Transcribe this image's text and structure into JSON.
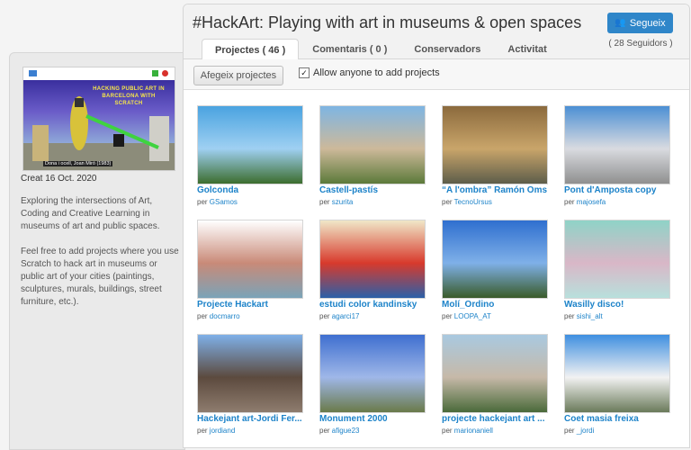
{
  "studio": {
    "title": "#HackArt: Playing with art in museums & open spaces",
    "follow_label": "Segueix",
    "followers": "( 28 Seguidors )",
    "tabs": [
      "Projectes ( 46 )",
      "Comentaris ( 0 )",
      "Conservadors",
      "Activitat"
    ],
    "add_projects_label": "Afegeix projectes",
    "allow_label": "Allow anyone to add projects",
    "allow_checked": true
  },
  "sidebar": {
    "thumb_title": "HACKING PUBLIC ART IN BARCELONA WITH SCRATCH",
    "thumb_caption": "Dona i ocell, Joan Miró (1983)",
    "created": "Creat 16 Oct. 2020",
    "description": [
      "Exploring the intersections of Art, Coding and Creative Learning in museums of art and public spaces.",
      "Feel free to add projects where you use Scratch to hack art in museums or public art of your cities (paintings, sculptures, murals, buildings, street furniture, etc.)."
    ]
  },
  "by_prefix": "per",
  "projects": [
    {
      "name": "Golconda",
      "author": "GSamos",
      "colors": [
        "#4aa3e0",
        "#9fd0f2",
        "#3c6d2e"
      ]
    },
    {
      "name": "Castell-pastís",
      "author": "szurita",
      "colors": [
        "#7eb5e3",
        "#cdb99a",
        "#5c7a3a"
      ]
    },
    {
      "name": "“A l'ombra” Ramón Oms",
      "author": "TecnoUrsus",
      "colors": [
        "#8b6a3d",
        "#c9a56a",
        "#5d5d4a"
      ]
    },
    {
      "name": "Pont d'Amposta copy",
      "author": "majosefa",
      "colors": [
        "#4c8fd4",
        "#d9dbe0",
        "#8f8f8f"
      ]
    },
    {
      "name": "Projecte Hackart",
      "author": "docmarro",
      "colors": [
        "#ffffff",
        "#c98a78",
        "#7aa3b8"
      ]
    },
    {
      "name": "estudi color kandinsky",
      "author": "agarci17",
      "colors": [
        "#f0e7c8",
        "#d83a2c",
        "#2b5fa8"
      ]
    },
    {
      "name": "Molí_Ordino",
      "author": "LOOPA_AT",
      "colors": [
        "#2f6fcf",
        "#7fb0e8",
        "#3a5b2a"
      ]
    },
    {
      "name": "Wasilly disco!",
      "author": "sishi_alt",
      "colors": [
        "#8fd3c7",
        "#d9b7c7",
        "#b8e0dc"
      ]
    },
    {
      "name": "Hackejant art-Jordi Fer...",
      "author": "jordiand",
      "colors": [
        "#7fb0e8",
        "#5c4a3e",
        "#8e7c6e"
      ]
    },
    {
      "name": "Monument 2000",
      "author": "afigue23",
      "colors": [
        "#3f6fd0",
        "#9fb7e8",
        "#6a7a4a"
      ]
    },
    {
      "name": "projecte hackejant art ...",
      "author": "marionaniell",
      "colors": [
        "#a9c9e0",
        "#c6b9a8",
        "#4a6a3a"
      ]
    },
    {
      "name": "Coet masia freixa",
      "author": "_jordi",
      "colors": [
        "#3f8fe0",
        "#f2f2f2",
        "#6a7a5a"
      ]
    }
  ]
}
